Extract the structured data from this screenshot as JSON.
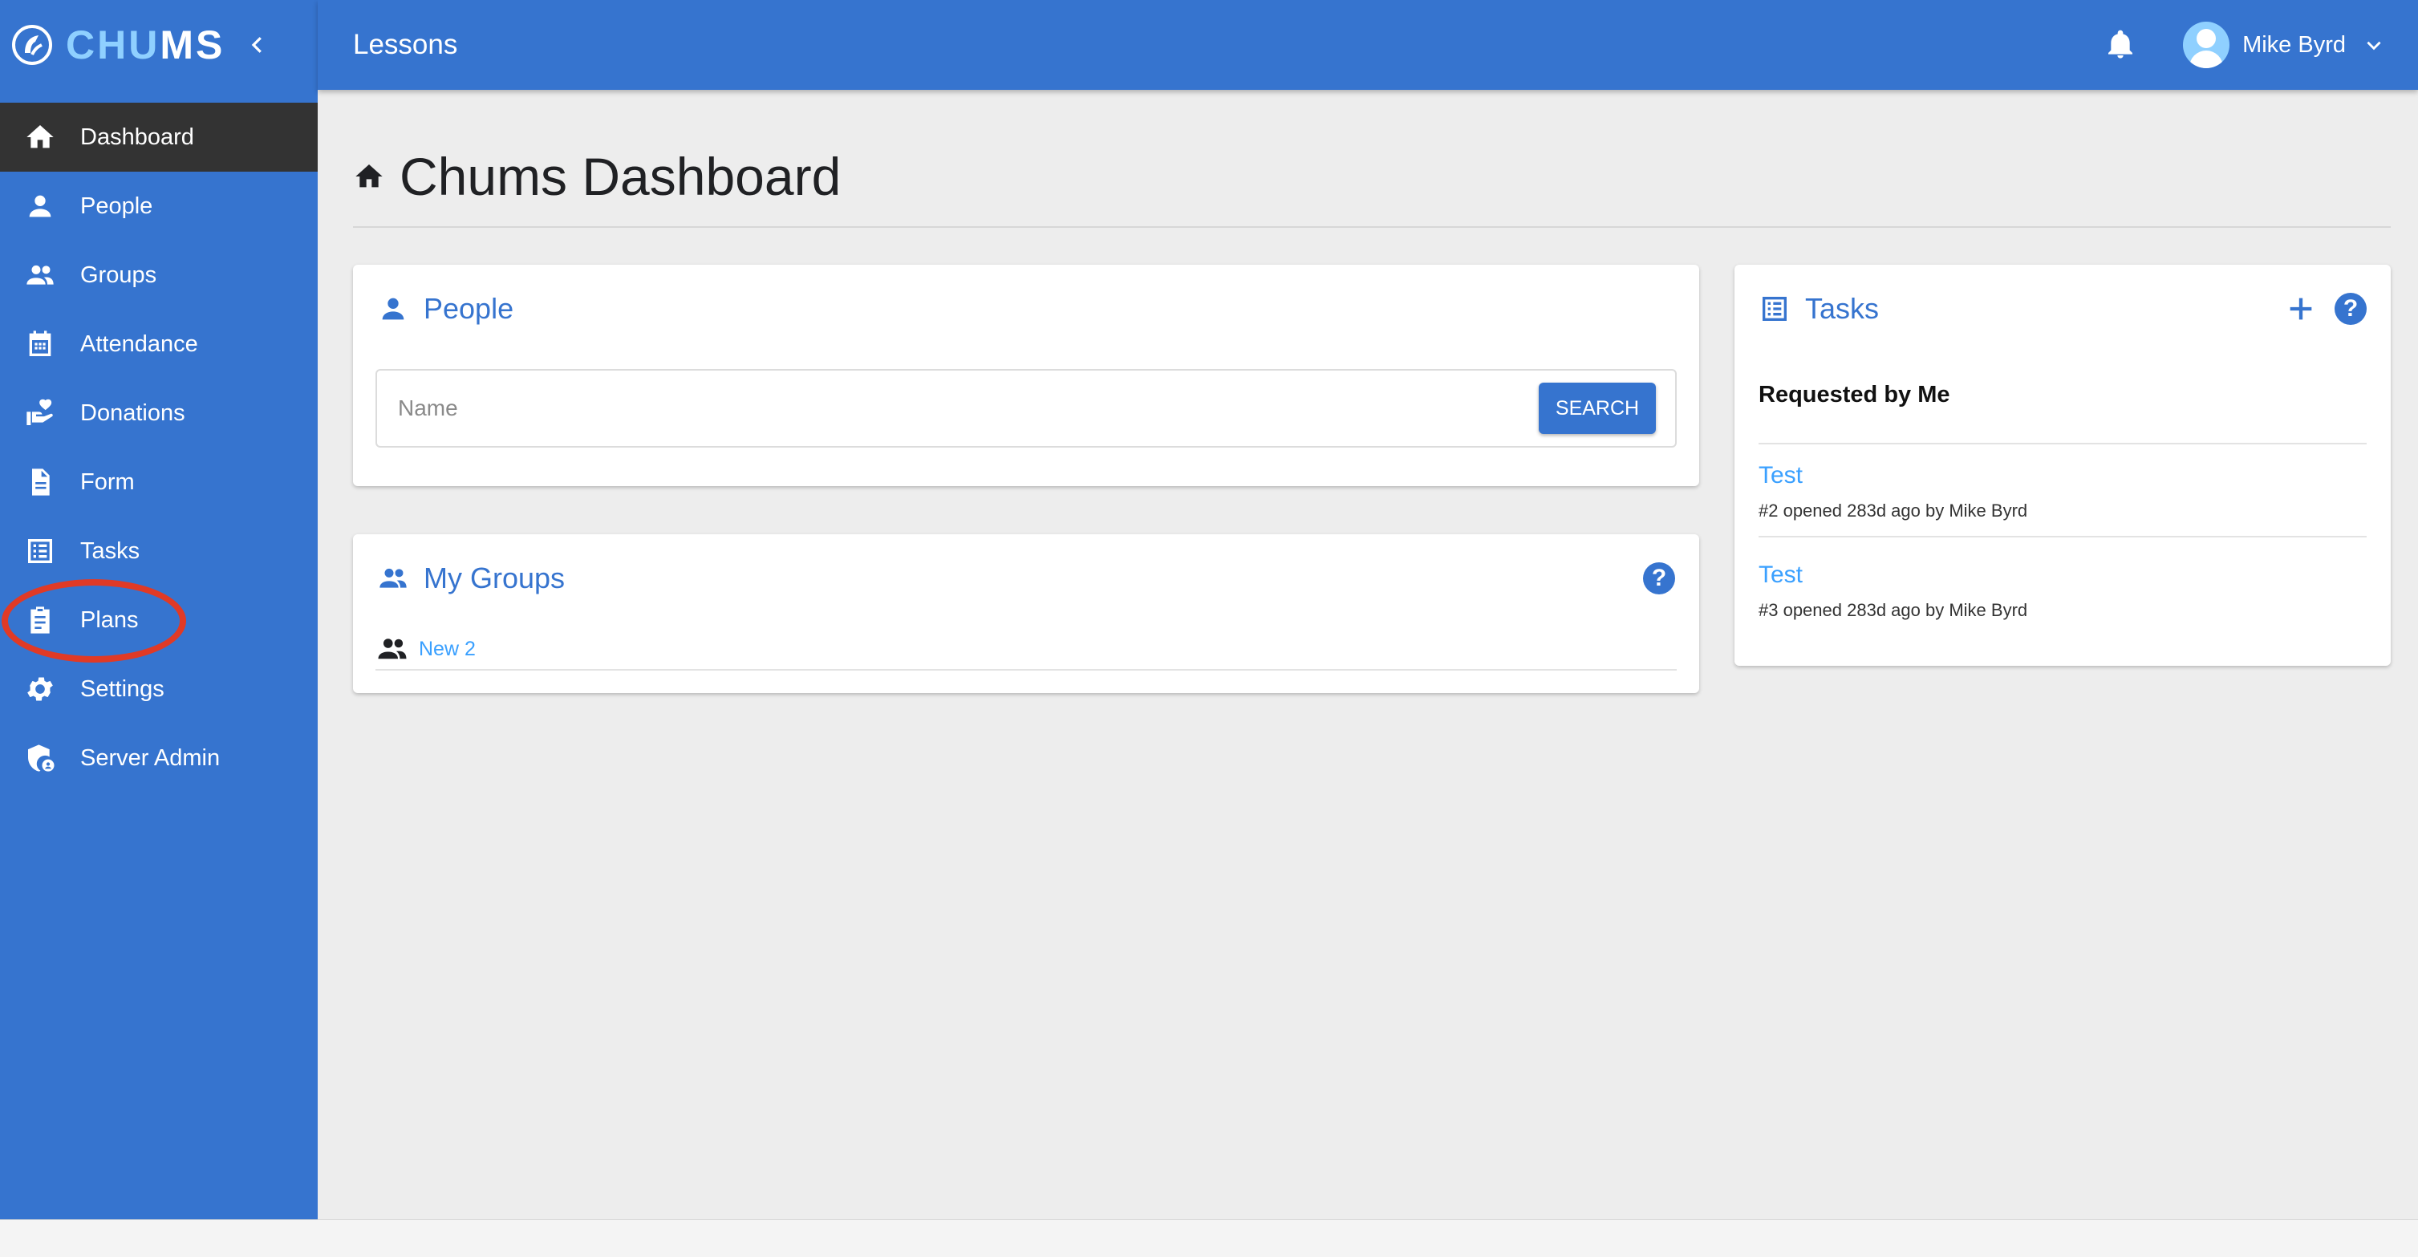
{
  "brand": {
    "logo_text_light": "CHU",
    "logo_text_white": "MS",
    "colors": {
      "primary": "#3674cf",
      "accent": "#8fd0ff",
      "active_nav": "#333333",
      "highlight": "#e03a26"
    }
  },
  "topbar": {
    "title": "Lessons",
    "user_name": "Mike Byrd"
  },
  "sidebar": {
    "items": [
      {
        "label": "Dashboard",
        "icon": "home-icon",
        "active": true
      },
      {
        "label": "People",
        "icon": "person-icon"
      },
      {
        "label": "Groups",
        "icon": "group-icon"
      },
      {
        "label": "Attendance",
        "icon": "calendar-icon"
      },
      {
        "label": "Donations",
        "icon": "donation-icon"
      },
      {
        "label": "Form",
        "icon": "document-icon"
      },
      {
        "label": "Tasks",
        "icon": "list-icon"
      },
      {
        "label": "Plans",
        "icon": "clipboard-icon",
        "highlighted": true
      },
      {
        "label": "Settings",
        "icon": "gear-icon"
      },
      {
        "label": "Server Admin",
        "icon": "shield-admin-icon"
      }
    ]
  },
  "main": {
    "page_title": "Chums Dashboard",
    "people_card": {
      "title": "People",
      "search_placeholder": "Name",
      "search_button": "SEARCH"
    },
    "groups_card": {
      "title": "My Groups",
      "groups": [
        {
          "name": "New 2"
        }
      ]
    },
    "tasks_card": {
      "title": "Tasks",
      "subheading": "Requested by Me",
      "tasks": [
        {
          "title": "Test",
          "meta": "#2 opened 283d ago by Mike Byrd"
        },
        {
          "title": "Test",
          "meta": "#3 opened 283d ago by Mike Byrd"
        }
      ]
    }
  }
}
